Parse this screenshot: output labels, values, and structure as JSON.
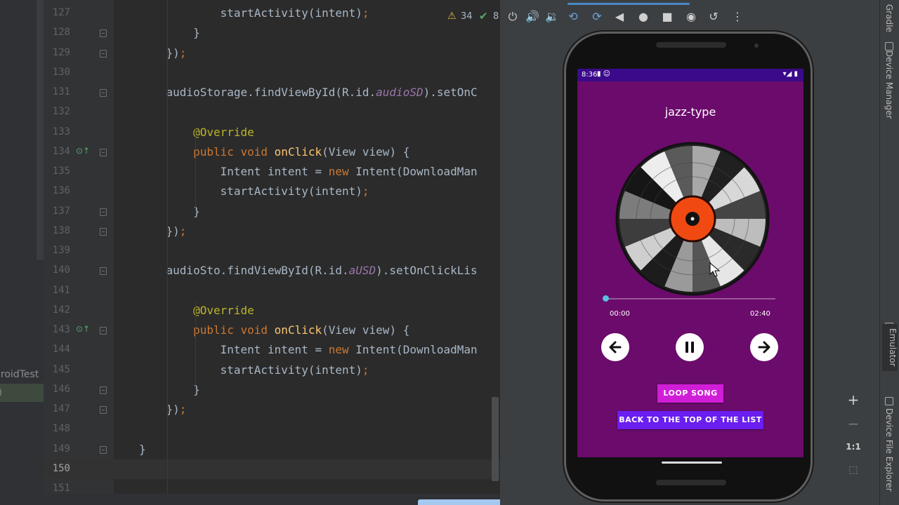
{
  "project_panel": {
    "items": [
      "droidTest",
      "t)"
    ]
  },
  "editor": {
    "lines": [
      {
        "n": "127",
        "code": "            startActivity(intent);"
      },
      {
        "n": "128",
        "code": "        }"
      },
      {
        "n": "129",
        "code": "    });"
      },
      {
        "n": "130",
        "code": ""
      },
      {
        "n": "131",
        "code": "    audioStorage.findViewById(R.id.audioSD).setOnC"
      },
      {
        "n": "132",
        "code": ""
      },
      {
        "n": "133",
        "code": "        @Override"
      },
      {
        "n": "134",
        "code": "        public void onClick(View view) {"
      },
      {
        "n": "135",
        "code": "            Intent intent = new Intent(DownloadMan"
      },
      {
        "n": "136",
        "code": "            startActivity(intent);"
      },
      {
        "n": "137",
        "code": "        }"
      },
      {
        "n": "138",
        "code": "    });"
      },
      {
        "n": "139",
        "code": ""
      },
      {
        "n": "140",
        "code": "    audioSto.findViewById(R.id.aUSD).setOnClickLis"
      },
      {
        "n": "141",
        "code": ""
      },
      {
        "n": "142",
        "code": "        @Override"
      },
      {
        "n": "143",
        "code": "        public void onClick(View view) {"
      },
      {
        "n": "144",
        "code": "            Intent intent = new Intent(DownloadMan"
      },
      {
        "n": "145",
        "code": "            startActivity(intent);"
      },
      {
        "n": "146",
        "code": "        }"
      },
      {
        "n": "147",
        "code": "    });"
      },
      {
        "n": "148",
        "code": ""
      },
      {
        "n": "149",
        "code": "}"
      },
      {
        "n": "150",
        "code": ""
      },
      {
        "n": "151",
        "code": ""
      }
    ],
    "inspections": {
      "warnings": "34",
      "weak_warnings": "8"
    }
  },
  "emulator": {
    "status_time": "8:36",
    "song_title": "jazz-type",
    "elapsed": "00:00",
    "total": "02:40",
    "progress": 0.0,
    "loop_label": "LOOP SONG",
    "back_label": "BACK TO THE TOP OF THE LIST",
    "zoom": {
      "in": "+",
      "out": "−",
      "actual": "1:1"
    },
    "colors": {
      "screen": "#6b0b6b",
      "status_bar": "#3a0a8a",
      "loop_button": "#d01ed8",
      "back_button": "#6a1ef0",
      "vinyl_label": "#f04a12"
    }
  },
  "tool_windows": {
    "gradle": "Gradle",
    "device_manager": "Device Manager",
    "emulator": "Emulator",
    "device_file_explorer": "Device File Explorer"
  },
  "icons": [
    "power-icon",
    "volume-up-icon",
    "volume-down-icon",
    "rotate-left-icon",
    "rotate-right-icon",
    "back-icon",
    "home-icon",
    "overview-icon",
    "screenshot-icon",
    "snapshot-icon",
    "more-icon"
  ]
}
